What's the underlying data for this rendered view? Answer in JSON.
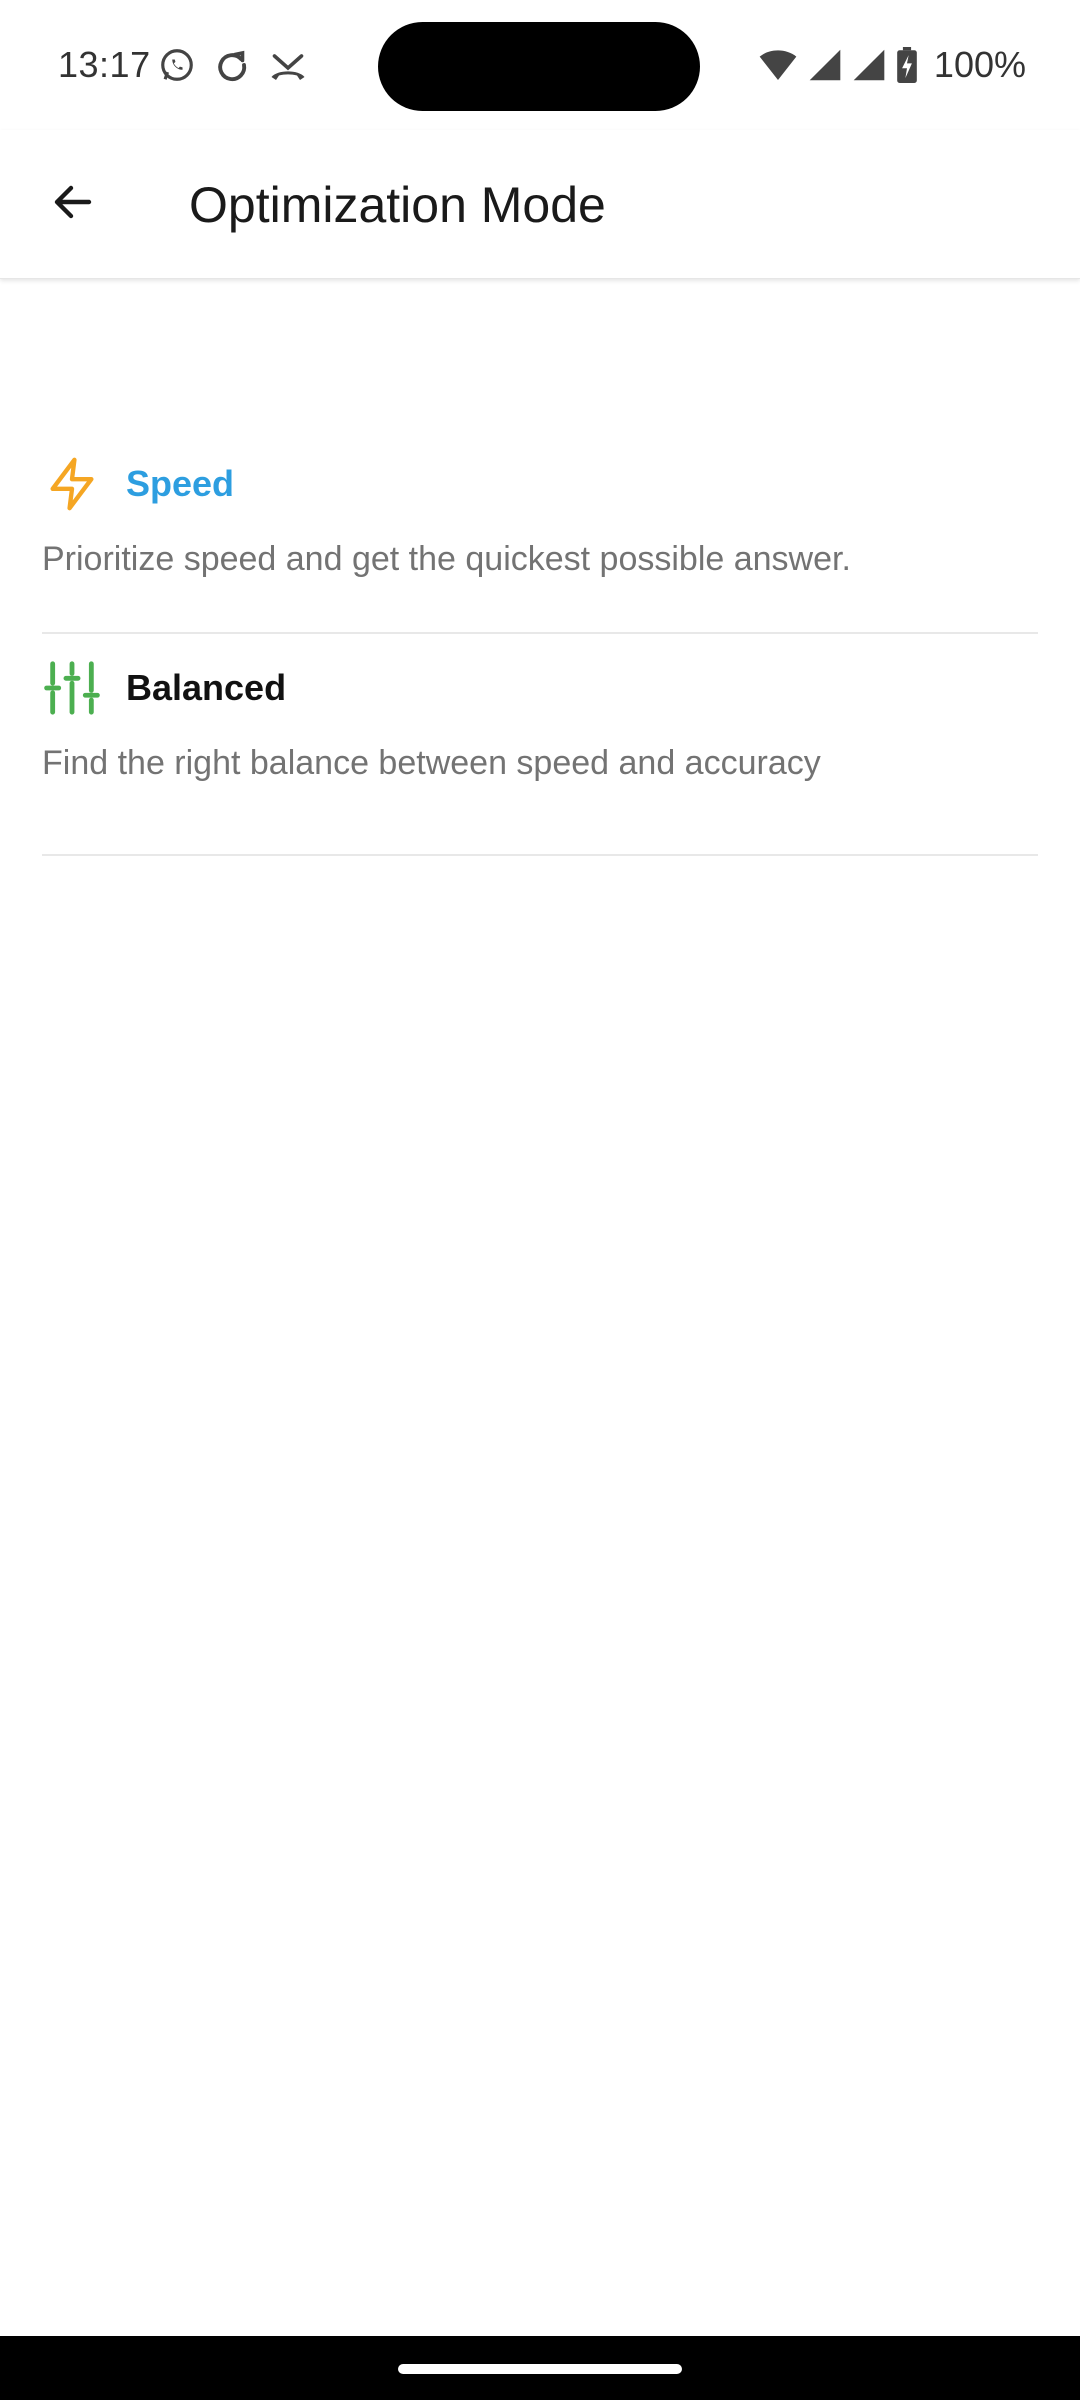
{
  "status_bar": {
    "time": "13:17",
    "battery": "100%",
    "icons": [
      "whatsapp-icon",
      "sync-icon",
      "missed-call-icon",
      "wifi-icon",
      "signal-icon",
      "signal-icon",
      "battery-charging-icon"
    ]
  },
  "app_bar": {
    "title": "Optimization Mode",
    "back_icon": "arrow-left-icon"
  },
  "options": [
    {
      "title": "Speed",
      "description": "Prioritize speed and get the quickest possible answer.",
      "icon": "lightning-icon",
      "icon_color": "#f5a623",
      "selected": true
    },
    {
      "title": "Balanced",
      "description": "Find the right balance between speed and accuracy",
      "icon": "sliders-icon",
      "icon_color": "#4caf50",
      "selected": false
    }
  ],
  "colors": {
    "selected_title": "#2d9ee0",
    "description": "#737373",
    "divider": "#e8e8e8"
  }
}
